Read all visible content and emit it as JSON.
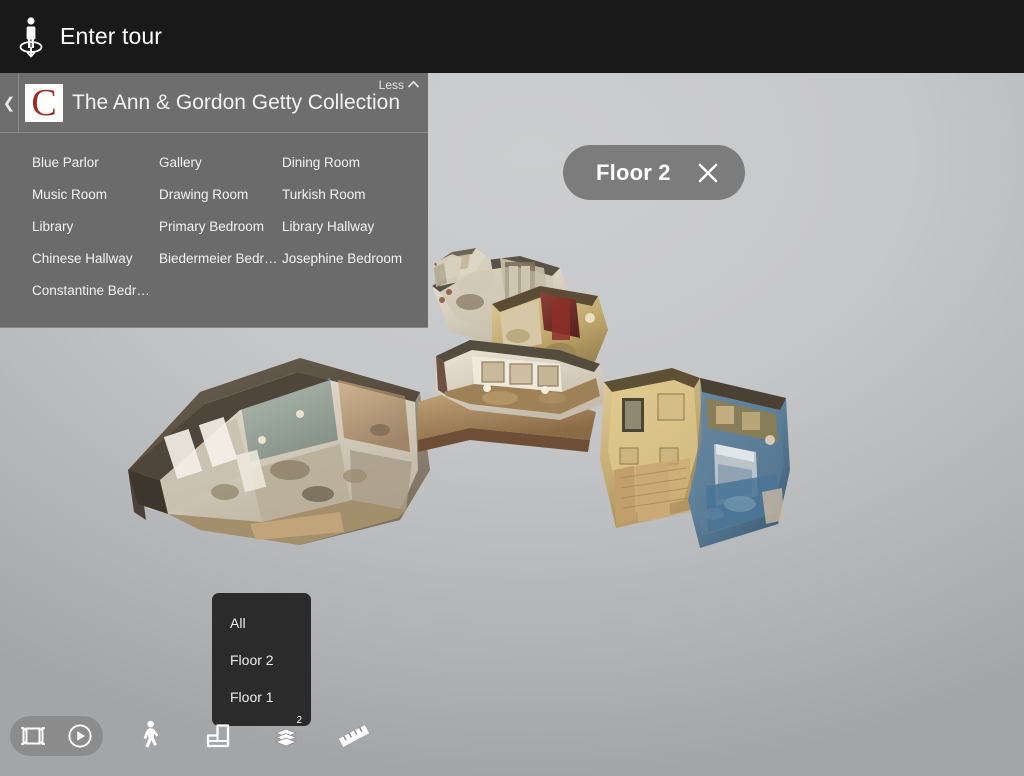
{
  "topbar": {
    "tour_label": "Enter tour",
    "tour_icon": "person-orbit-icon"
  },
  "panel": {
    "collapse_icon": "chevron-left-icon",
    "logo_letter": "C",
    "title": "The Ann & Gordon Getty Collection",
    "less_label": "Less",
    "less_icon": "chevron-up-icon",
    "rooms": [
      "Blue Parlor",
      "Gallery",
      "Dining Room",
      "Music Room",
      "Drawing Room",
      "Turkish Room",
      "Library",
      "Primary Bedroom",
      "Library Hallway",
      "Chinese Hallway",
      "Biedermeier Bedro...",
      "Josephine Bedroom",
      "Constantine Bedro..."
    ]
  },
  "floor_badge": {
    "label": "Floor 2",
    "close_icon": "close-icon"
  },
  "floor_menu": {
    "items": [
      "All",
      "Floor 2",
      "Floor 1"
    ],
    "selected": "Floor 2"
  },
  "toolbar": {
    "items": [
      {
        "name": "panorama-view-button",
        "icon": "panorama-icon"
      },
      {
        "name": "play-highlight-reel-button",
        "icon": "play-circle-icon"
      },
      {
        "name": "walkthrough-view-button",
        "icon": "walking-person-icon"
      },
      {
        "name": "floorplan-view-button",
        "icon": "floorplan-icon"
      },
      {
        "name": "floors-layers-button",
        "icon": "layers-icon",
        "badge": "2"
      },
      {
        "name": "measure-tool-button",
        "icon": "ruler-icon"
      }
    ]
  },
  "colors": {
    "topbar_bg": "#191919",
    "panel_bg": "#6b6b6b",
    "panel_header_bg": "#6e6e6e",
    "badge_bg": "#7c7c7c",
    "menu_bg": "#2b2b2b",
    "logo_red": "#9e2a22",
    "viewport_bg": "#c6c7c9"
  }
}
